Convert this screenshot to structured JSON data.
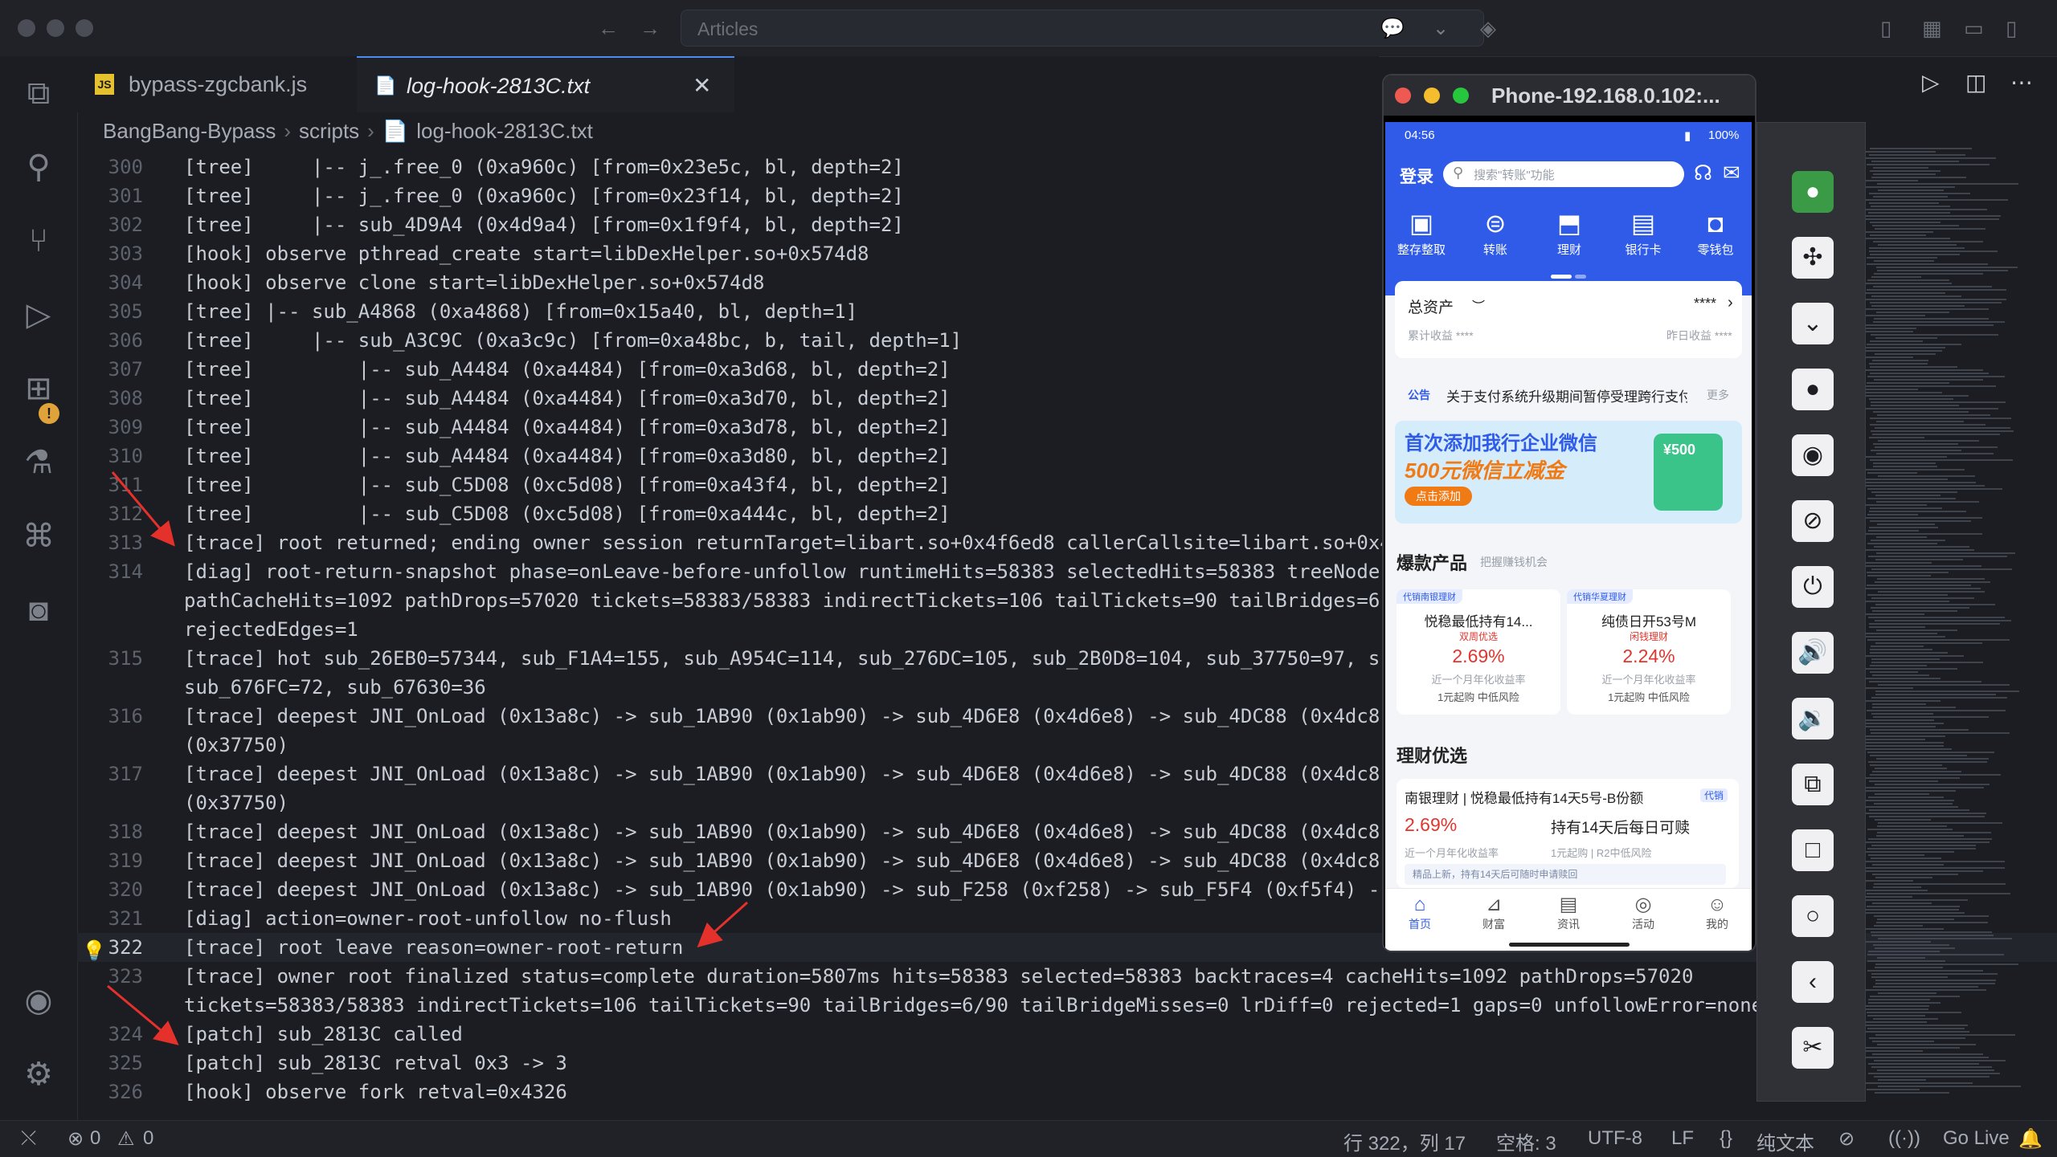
{
  "window": {
    "command_center_text": "Articles"
  },
  "tabs": [
    {
      "icon": "JS",
      "label": "bypass-zgcbank.js",
      "active": false
    },
    {
      "icon": "📄",
      "label": "log-hook-2813C.txt",
      "active": true,
      "close": "✕"
    }
  ],
  "breadcrumb": [
    "BangBang-Bypass",
    "scripts",
    "log-hook-2813C.txt"
  ],
  "editor": {
    "lines": [
      {
        "n": "300",
        "text": "[tree]     |-- j_.free_0 (0xa960c) [from=0x23e5c, bl, depth=2]"
      },
      {
        "n": "301",
        "text": "[tree]     |-- j_.free_0 (0xa960c) [from=0x23f14, bl, depth=2]"
      },
      {
        "n": "302",
        "text": "[tree]     |-- sub_4D9A4 (0x4d9a4) [from=0x1f9f4, bl, depth=2]"
      },
      {
        "n": "303",
        "text": "[hook] observe pthread_create start=libDexHelper.so+0x574d8"
      },
      {
        "n": "304",
        "text": "[hook] observe clone start=libDexHelper.so+0x574d8"
      },
      {
        "n": "305",
        "text": "[tree] |-- sub_A4868 (0xa4868) [from=0x15a40, bl, depth=1]"
      },
      {
        "n": "306",
        "text": "[tree]     |-- sub_A3C9C (0xa3c9c) [from=0xa48bc, b, tail, depth=1]"
      },
      {
        "n": "307",
        "text": "[tree]         |-- sub_A4484 (0xa4484) [from=0xa3d68, bl, depth=2]"
      },
      {
        "n": "308",
        "text": "[tree]         |-- sub_A4484 (0xa4484) [from=0xa3d70, bl, depth=2]"
      },
      {
        "n": "309",
        "text": "[tree]         |-- sub_A4484 (0xa4484) [from=0xa3d78, bl, depth=2]"
      },
      {
        "n": "310",
        "text": "[tree]         |-- sub_A4484 (0xa4484) [from=0xa3d80, bl, depth=2]"
      },
      {
        "n": "311",
        "text": "[tree]         |-- sub_C5D08 (0xc5d08) [from=0xa43f4, bl, depth=2]"
      },
      {
        "n": "312",
        "text": "[tree]         |-- sub_C5D08 (0xc5d08) [from=0xa444c, bl, depth=2]"
      },
      {
        "n": "313",
        "text": "[trace] root returned; ending owner session returnTarget=libart.so+0x4f6ed8 callerCallsite=libart.so+0x4"
      },
      {
        "n": "314",
        "text": "[diag] root-return-snapshot phase=onLeave-before-unfollow runtimeHits=58383 selectedHits=58383 treeNode"
      },
      {
        "n": "",
        "text": "pathCacheHits=1092 pathDrops=57020 tickets=58383/58383 indirectTickets=106 tailTickets=90 tailBridges=6"
      },
      {
        "n": "",
        "text": "rejectedEdges=1"
      },
      {
        "n": "315",
        "text": "[trace] hot sub_26EB0=57344, sub_F1A4=155, sub_A954C=114, sub_276DC=105, sub_2B0D8=104, sub_37750=97, s"
      },
      {
        "n": "",
        "text": "sub_676FC=72, sub_67630=36"
      },
      {
        "n": "316",
        "text": "[trace] deepest JNI_OnLoad (0x13a8c) -> sub_1AB90 (0x1ab90) -> sub_4D6E8 (0x4d6e8) -> sub_4DC88 (0x4dc8"
      },
      {
        "n": "",
        "text": "(0x37750)"
      },
      {
        "n": "317",
        "text": "[trace] deepest JNI_OnLoad (0x13a8c) -> sub_1AB90 (0x1ab90) -> sub_4D6E8 (0x4d6e8) -> sub_4DC88 (0x4dc8"
      },
      {
        "n": "",
        "text": "(0x37750)"
      },
      {
        "n": "318",
        "text": "[trace] deepest JNI_OnLoad (0x13a8c) -> sub_1AB90 (0x1ab90) -> sub_4D6E8 (0x4d6e8) -> sub_4DC88 (0x4dc8"
      },
      {
        "n": "319",
        "text": "[trace] deepest JNI_OnLoad (0x13a8c) -> sub_1AB90 (0x1ab90) -> sub_4D6E8 (0x4d6e8) -> sub_4DC88 (0x4dc8"
      },
      {
        "n": "320",
        "text": "[trace] deepest JNI_OnLoad (0x13a8c) -> sub_1AB90 (0x1ab90) -> sub_F258 (0xf258) -> sub_F5F4 (0xf5f4) -"
      },
      {
        "n": "321",
        "text": "[diag] action=owner-root-unfollow no-flush"
      },
      {
        "n": "322",
        "text": "[trace] root leave reason=owner-root-return",
        "active": true
      },
      {
        "n": "323",
        "text": "[trace] owner root finalized status=complete duration=5807ms hits=58383 selected=58383 backtraces=4 cacheHits=1092 pathDrops=57020"
      },
      {
        "n": "",
        "text": "tickets=58383/58383 indirectTickets=106 tailTickets=90 tailBridges=6/90 tailBridgeMisses=0 lrDiff=0 rejected=1 gaps=0 unfollowError=none"
      },
      {
        "n": "324",
        "text": "[patch] sub_2813C called"
      },
      {
        "n": "325",
        "text": "[patch] sub_2813C retval 0x3 -> 3"
      },
      {
        "n": "326",
        "text": "[hook] observe fork retval=0x4326"
      }
    ]
  },
  "statusbar": {
    "errors": "0",
    "warnings": "0",
    "position": "行 322，列 17",
    "indent": "空格: 3",
    "encoding": "UTF-8",
    "eol": "LF",
    "language": "纯文本",
    "golive": "Go Live"
  },
  "phone": {
    "window_title": "Phone-192.168.0.102:...",
    "status_time": "04:56",
    "battery": "100%",
    "login": "登录",
    "search_placeholder": "搜索\"转账\"功能",
    "quick": [
      "整存整取",
      "转账",
      "理财",
      "银行卡",
      "零钱包"
    ],
    "assets_label": "总资产",
    "assets_masked": "****",
    "accum_label": "累计收益 ****",
    "yesterday_label": "昨日收益 ****",
    "notice_tag": "公告",
    "notice_text": "关于支付系统升级期间暂停受理跨行支付",
    "notice_more": "更多",
    "banner_title": "首次添加我行企业微信",
    "banner_sub": "500元微信立减金",
    "banner_btn": "点击添加",
    "banner_badge": "¥500",
    "hot_title": "爆款产品",
    "hot_sub": "把握赚钱机会",
    "products": [
      {
        "tag": "代销南银理财",
        "name": "悦稳最低持有14...",
        "badge": "双周优选",
        "rate": "2.69%",
        "rate_label": "近一个月年化收益率",
        "meta": "1元起购  中低风险"
      },
      {
        "tag": "代销华夏理财",
        "name": "纯债日开53号M",
        "badge": "闲钱理财",
        "rate": "2.24%",
        "rate_label": "近一个月年化收益率",
        "meta": "1元起购  中低风险"
      }
    ],
    "lc_title": "理财优选",
    "lc_name": "南银理财 | 悦稳最低持有14天5号-B份额",
    "lc_tag": "代销",
    "lc_rate": "2.69%",
    "lc_rate_label": "近一个月年化收益率",
    "lc_desc": "持有14天后每日可赎",
    "lc_meta": "1元起购 | R2中低风险",
    "lc_note": "精品上新，持有14天后可随时申请赎回",
    "nav": [
      "首页",
      "财富",
      "资讯",
      "活动",
      "我的"
    ]
  },
  "colors": {
    "accent_blue": "#2f5be8",
    "arrow_red": "#e5312b",
    "rate_red": "#e3352d"
  }
}
